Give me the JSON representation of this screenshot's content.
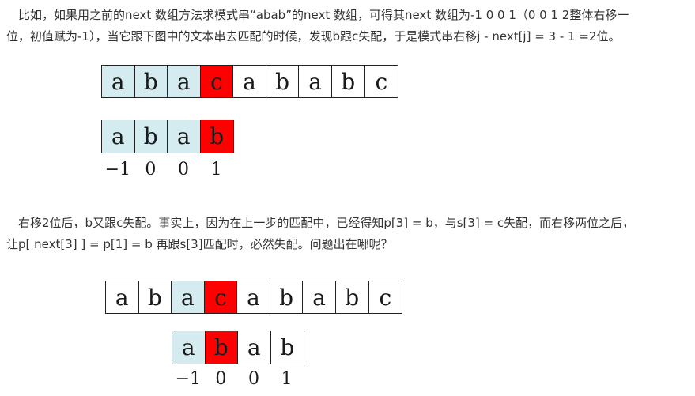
{
  "paragraph1": {
    "line1": "　比如，如果用之前的next 数组方法求模式串“abab”的next 数组，可得其next 数组为-1 0 0 1（0 0 1 2整体右移一",
    "line2": "位，初值赋为-1），当它跟下图中的文本串去匹配的时候，发现b跟c失配，于是模式串右移j - next[j] = 3 - 1 =2位。"
  },
  "figure1": {
    "text": [
      "a",
      "b",
      "a",
      "c",
      "a",
      "b",
      "a",
      "b",
      "c"
    ],
    "text_colors": [
      "blue",
      "blue",
      "blue",
      "red",
      "white",
      "white",
      "white",
      "white",
      "white"
    ],
    "pattern": [
      "a",
      "b",
      "a",
      "b"
    ],
    "pattern_colors": [
      "blue",
      "blue",
      "blue",
      "red"
    ],
    "next": [
      "−1",
      "0",
      "0",
      "1"
    ]
  },
  "paragraph2": {
    "line1": "　右移2位后，b又跟c失配。事实上，因为在上一步的匹配中，已经得知p[3] = b，与s[3] = c失配，而右移两位之后，",
    "line2": "让p[ next[3] ] = p[1] = b 再跟s[3]匹配时，必然失配。问题出在哪呢？"
  },
  "figure2": {
    "text": [
      "a",
      "b",
      "a",
      "c",
      "a",
      "b",
      "a",
      "b",
      "c"
    ],
    "text_colors": [
      "white",
      "white",
      "blue",
      "red",
      "white",
      "white",
      "white",
      "white",
      "white"
    ],
    "pattern": [
      "a",
      "b",
      "a",
      "b"
    ],
    "pattern_colors": [
      "blue",
      "red",
      "white",
      "white"
    ],
    "next": [
      "−1",
      "0",
      "0",
      "1"
    ]
  },
  "colors": {
    "blue": "#d4ebf0",
    "red": "#ff0000",
    "white": "#ffffff"
  }
}
